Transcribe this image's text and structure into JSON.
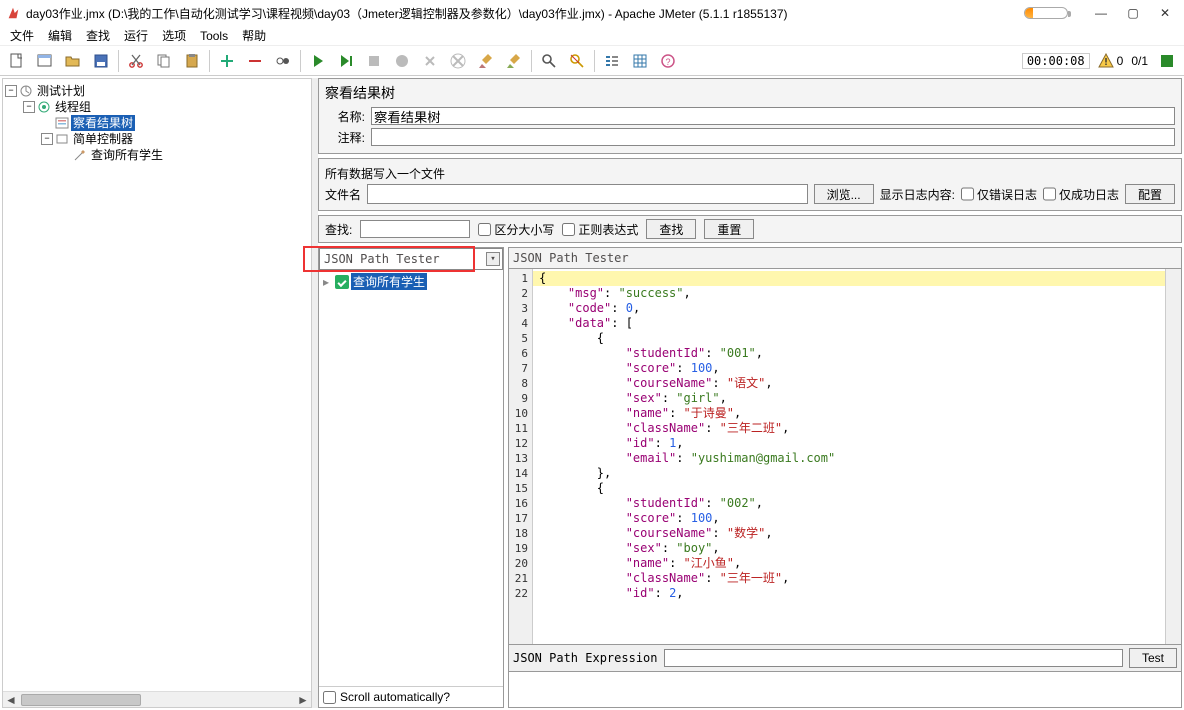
{
  "titlebar": {
    "app_icon_color": "#d8443b",
    "title": "day03作业.jmx (D:\\我的工作\\自动化测试学习\\课程视频\\day03（Jmeter逻辑控制器及参数化）\\day03作业.jmx) - Apache JMeter (5.1.1 r1855137)"
  },
  "menu": {
    "file": "文件",
    "edit": "编辑",
    "search": "查找",
    "run": "运行",
    "options": "选项",
    "tools": "Tools",
    "help": "帮助"
  },
  "toolbar": {
    "timer": "00:00:08",
    "warn_count": "0",
    "frac": "0/1"
  },
  "tree": {
    "root": "测试计划",
    "tg": "线程组",
    "vr": "察看结果树",
    "sc": "简单控制器",
    "req": "查询所有学生"
  },
  "panel": {
    "header": "察看结果树",
    "name_lbl": "名称:",
    "name_val": "察看结果树",
    "comment_lbl": "注释:",
    "file_header": "所有数据写入一个文件",
    "file_lbl": "文件名",
    "browse": "浏览...",
    "log_lbl": "显示日志内容:",
    "err_only": "仅错误日志",
    "ok_only": "仅成功日志",
    "cfg": "配置"
  },
  "search": {
    "lbl": "查找:",
    "case": "区分大小写",
    "regex": "正则表达式",
    "find": "查找",
    "reset": "重置"
  },
  "combo": {
    "value": "JSON Path Tester"
  },
  "res_tree": {
    "item": "查询所有学生"
  },
  "scroll_auto": "Scroll automatically?",
  "tester_tab": "JSON Path Tester",
  "json_lines": [
    "{",
    "    \"msg\": \"success\",",
    "    \"code\": 0,",
    "    \"data\": [",
    "        {",
    "            \"studentId\": \"001\",",
    "            \"score\": 100,",
    "            \"courseName\": \"语文\",",
    "            \"sex\": \"girl\",",
    "            \"name\": \"于诗曼\",",
    "            \"className\": \"三年二班\",",
    "            \"id\": 1,",
    "            \"email\": \"yushiman@gmail.com\"",
    "        },",
    "        {",
    "            \"studentId\": \"002\",",
    "            \"score\": 100,",
    "            \"courseName\": \"数学\",",
    "            \"sex\": \"boy\",",
    "            \"name\": \"江小鱼\",",
    "            \"className\": \"三年一班\",",
    "            \"id\": 2,"
  ],
  "expr": {
    "lbl": "JSON Path Expression",
    "test": "Test"
  }
}
